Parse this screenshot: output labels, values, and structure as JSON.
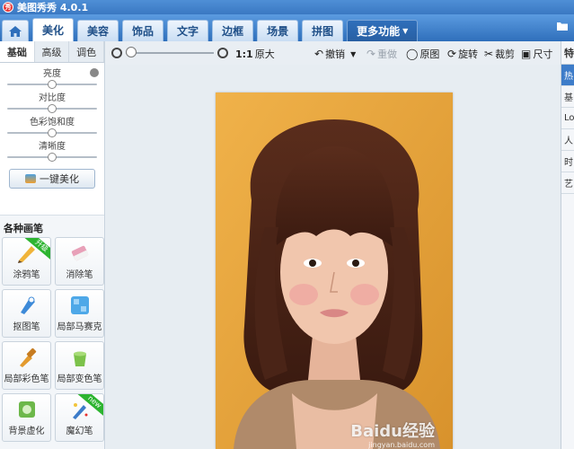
{
  "window": {
    "title": "美图秀秀 4.0.1",
    "logo_text": "秀"
  },
  "nav": {
    "tabs": [
      {
        "label": "美化"
      },
      {
        "label": "美容"
      },
      {
        "label": "饰品"
      },
      {
        "label": "文字"
      },
      {
        "label": "边框"
      },
      {
        "label": "场景"
      },
      {
        "label": "拼图"
      }
    ],
    "more_label": "更多功能",
    "active_tab": "美化"
  },
  "left_panel": {
    "subtabs": [
      {
        "label": "基础"
      },
      {
        "label": "高级"
      },
      {
        "label": "调色"
      }
    ],
    "active_subtab": "基础",
    "sliders": [
      {
        "label": "亮度",
        "value": 0.5
      },
      {
        "label": "对比度",
        "value": 0.5
      },
      {
        "label": "色彩饱和度",
        "value": 0.5
      },
      {
        "label": "清晰度",
        "value": 0.5
      }
    ],
    "beautify_label": "一键美化",
    "brushes_title": "各种画笔",
    "brushes": [
      {
        "label": "涂鸦笔",
        "badge": "升级",
        "icon": "pencil-icon"
      },
      {
        "label": "消除笔",
        "badge": "",
        "icon": "eraser-icon"
      },
      {
        "label": "抠图笔",
        "badge": "",
        "icon": "cutout-pen-icon"
      },
      {
        "label": "局部马赛克",
        "badge": "",
        "icon": "mosaic-icon"
      },
      {
        "label": "局部彩色笔",
        "badge": "",
        "icon": "color-brush-icon"
      },
      {
        "label": "局部变色笔",
        "badge": "",
        "icon": "paint-bucket-icon"
      },
      {
        "label": "背景虚化",
        "badge": "",
        "icon": "blur-icon"
      },
      {
        "label": "魔幻笔",
        "badge": "new",
        "icon": "magic-wand-icon"
      }
    ]
  },
  "toolbar": {
    "zoom_level": 0.0,
    "one_to_one": "1:1",
    "original_size": "原大",
    "undo": "撤销",
    "redo": "重做",
    "original": "原图",
    "rotate": "旋转",
    "crop": "裁剪",
    "size": "尺寸"
  },
  "right_panel": {
    "top_label": "特",
    "items": [
      {
        "label": "热",
        "active": true
      },
      {
        "label": "基"
      },
      {
        "label": "Lo"
      },
      {
        "label": "人"
      },
      {
        "label": "时"
      },
      {
        "label": "艺"
      }
    ]
  },
  "watermark": {
    "text": "Baidu经验",
    "sub": "jingyan.baidu.com"
  },
  "colors": {
    "nav_blue": "#3a78c2",
    "canvas_bg": "#e7edf2",
    "photo_bg": "#e7a33a"
  }
}
